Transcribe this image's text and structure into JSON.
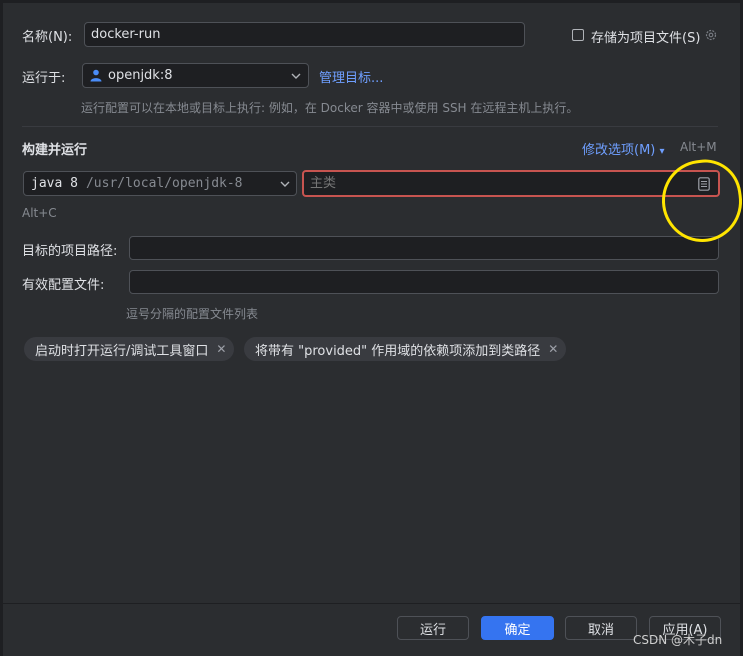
{
  "name_row": {
    "label": "名称(N):",
    "value": "docker-run",
    "store_as_project_label": "存储为项目文件(S)"
  },
  "run_on": {
    "label": "运行于:",
    "target": "openjdk:8",
    "manage_link": "管理目标...",
    "hint": "运行配置可以在本地或目标上执行: 例如，在 Docker 容器中或使用 SSH 在远程主机上执行。"
  },
  "build_run": {
    "title": "构建并运行",
    "modify_options": "修改选项(M)",
    "modify_shortcut": "Alt+M",
    "jdk_name": "java 8",
    "jdk_path": "/usr/local/openjdk-8",
    "main_class_placeholder": "主类",
    "shortcut_hint": "Alt+C"
  },
  "target_path": {
    "label": "目标的项目路径:",
    "value": ""
  },
  "active_profiles": {
    "label": "有效配置文件:",
    "value": "",
    "hint": "逗号分隔的配置文件列表"
  },
  "chips": [
    {
      "label": "启动时打开运行/调试工具窗口"
    },
    {
      "label": "将带有 \"provided\" 作用域的依赖项添加到类路径"
    }
  ],
  "buttons": {
    "run": "运行",
    "ok": "确定",
    "cancel": "取消",
    "apply": "应用(A)"
  },
  "watermark": "CSDN @木子dn",
  "colors": {
    "background": "#2b2d30",
    "accent": "#3574f0",
    "link": "#6f9fff",
    "error_border": "#c75450",
    "annotation": "#ffe500"
  }
}
